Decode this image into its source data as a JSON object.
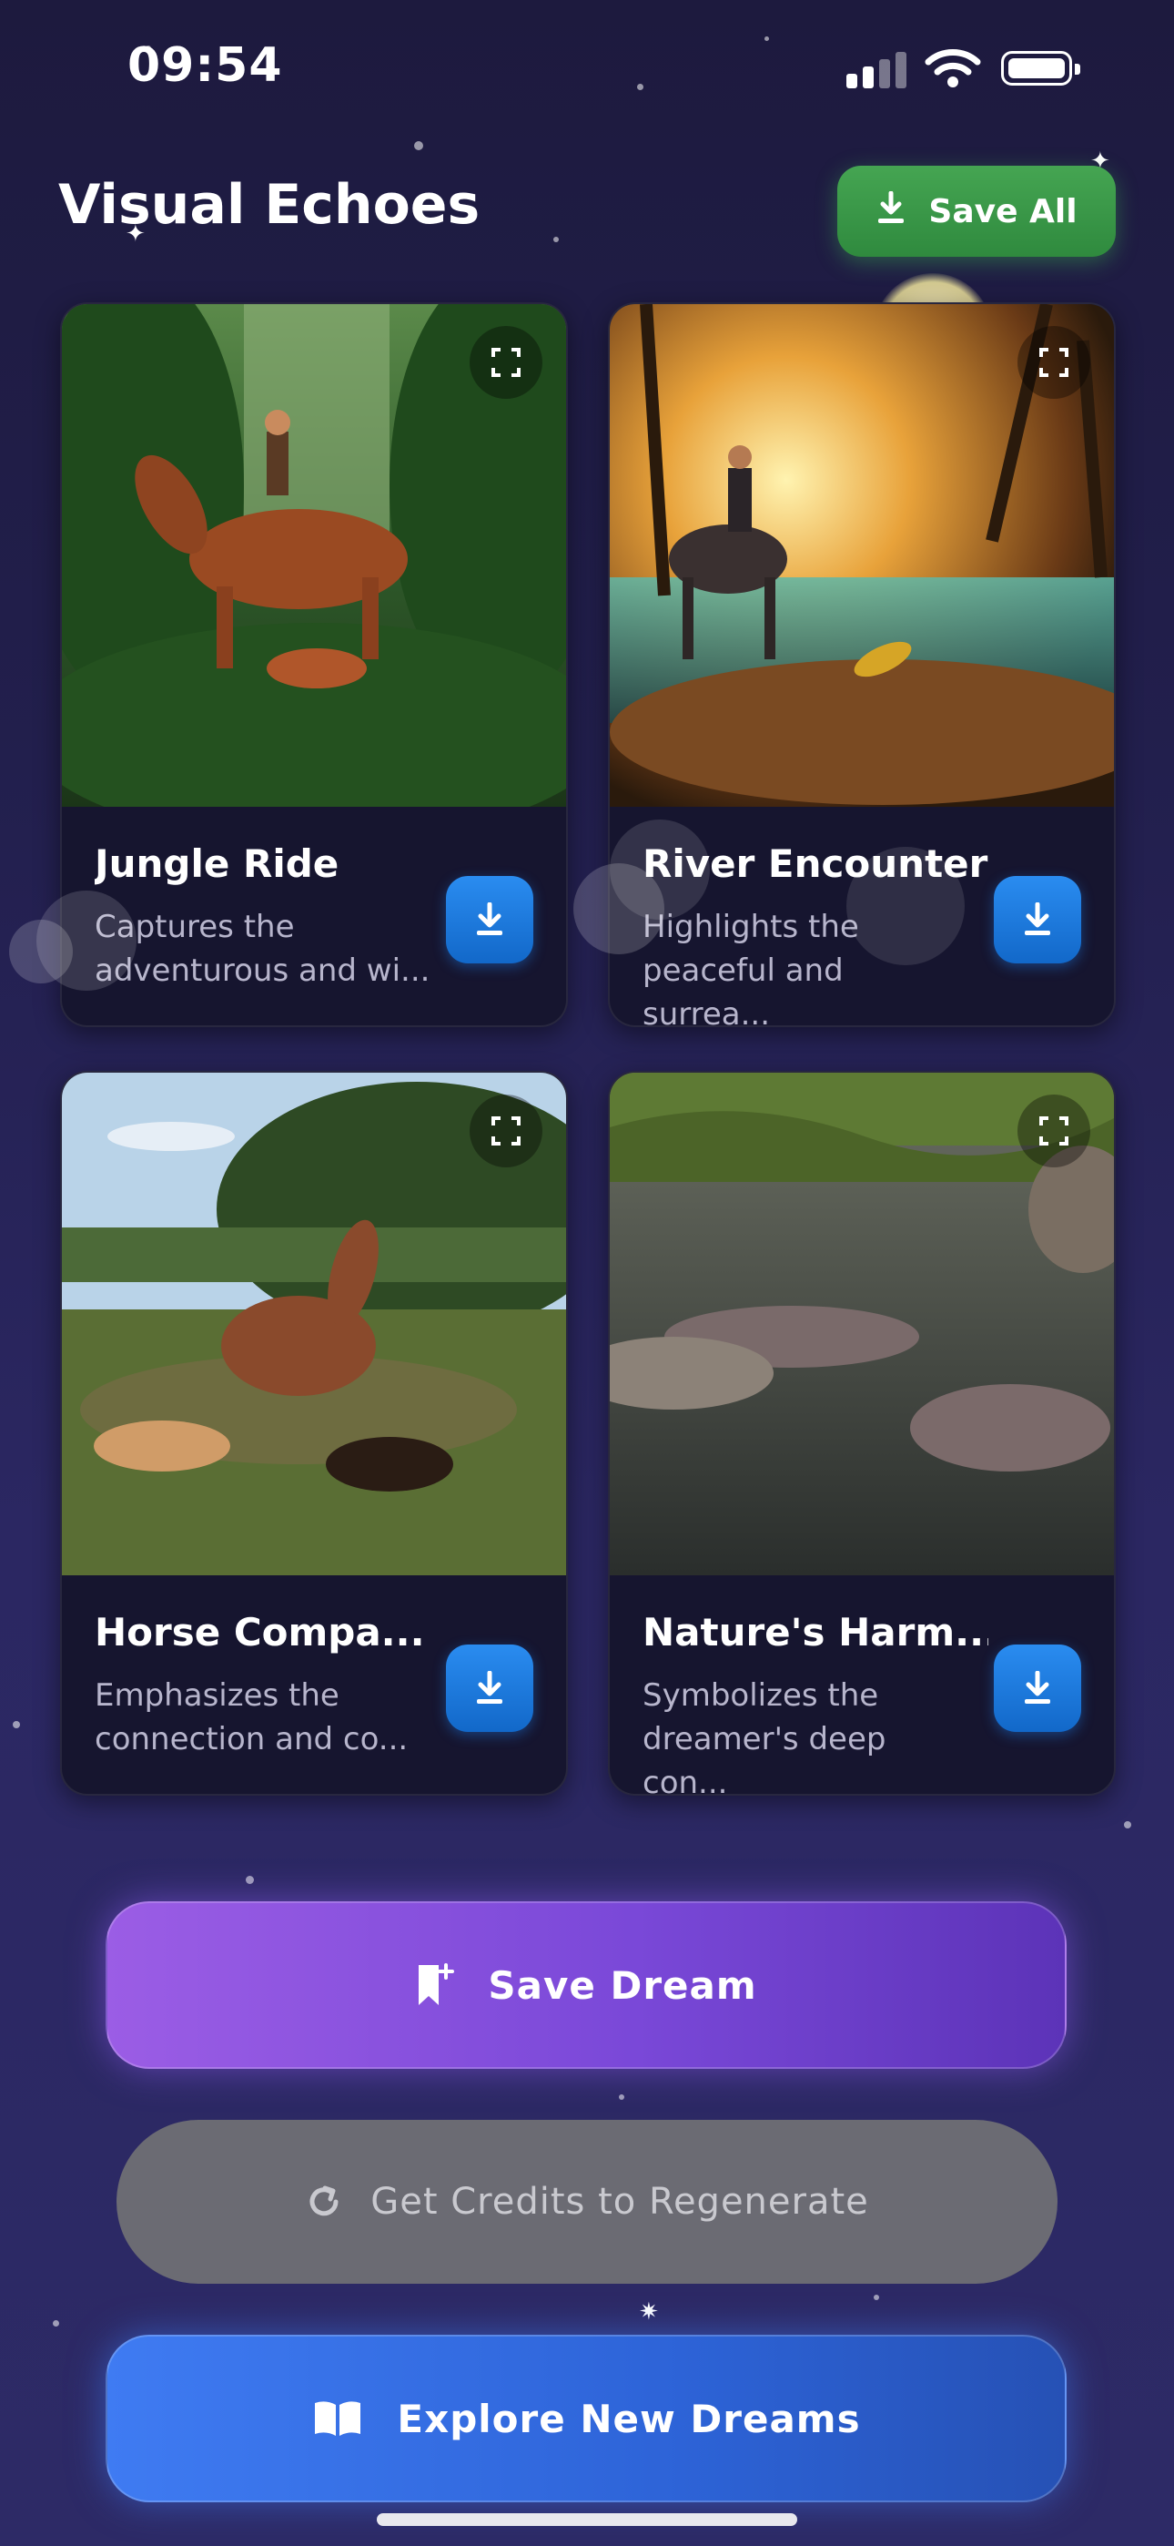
{
  "status_bar": {
    "time": "09:54"
  },
  "header": {
    "title": "Visual Echoes",
    "save_all_label": "Save All"
  },
  "cards": [
    {
      "title": "Jungle Ride",
      "description": "Captures the\nadventurous and wi..."
    },
    {
      "title": "River Encounter",
      "description": "Highlights the\npeaceful and surrea..."
    },
    {
      "title": "Horse Compa...",
      "description": "Emphasizes the\nconnection and co..."
    },
    {
      "title": "Nature's Harm...",
      "description": "Symbolizes the\ndreamer's deep con..."
    }
  ],
  "actions": {
    "save_dream": "Save Dream",
    "get_credits": "Get Credits to Regenerate",
    "explore": "Explore New Dreams"
  },
  "icons": {
    "download": "download-icon",
    "expand": "expand-icon",
    "bookmark_add": "bookmark-add-icon",
    "refresh": "refresh-icon",
    "book": "book-open-icon"
  },
  "colors": {
    "save_all": "#3a9a48",
    "download": "#1f7ae0",
    "save_dream": "#8b55e0",
    "explore": "#3569df",
    "credits": "#6b6b73"
  }
}
